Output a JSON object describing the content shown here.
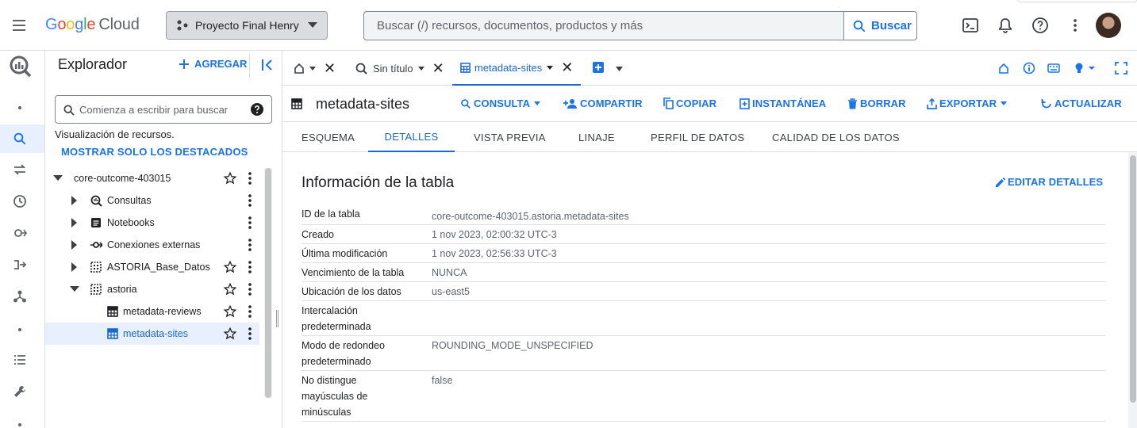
{
  "brand": {
    "google": "Google",
    "cloud": "Cloud"
  },
  "project": {
    "name": "Proyecto Final Henry"
  },
  "search": {
    "placeholder": "Buscar (/) recursos, documentos, productos y más",
    "button": "Buscar"
  },
  "explorer": {
    "title": "Explorador",
    "add": "AGREGAR",
    "search_placeholder": "Comienza a escribir para buscar",
    "resources_text": "Visualización de recursos.",
    "starred_link": "MOSTRAR SOLO LOS DESTACADOS",
    "tree": [
      {
        "label": "core-outcome-403015",
        "expanded": true,
        "icon": "none",
        "starred": false
      },
      {
        "label": "Consultas",
        "icon": "query-icon"
      },
      {
        "label": "Notebooks",
        "icon": "notebook-icon"
      },
      {
        "label": "Conexiones externas",
        "icon": "connection-icon"
      },
      {
        "label": "ASTORIA_Base_Datos",
        "icon": "dataset-icon"
      },
      {
        "label": "astoria",
        "icon": "dataset-icon",
        "expanded": true
      },
      {
        "label": "metadata-reviews",
        "icon": "table-icon"
      },
      {
        "label": "metadata-sites",
        "icon": "table-icon",
        "selected": true
      }
    ]
  },
  "tabs": [
    {
      "label": "",
      "icon": "home-icon"
    },
    {
      "label": "Sin título",
      "icon": "query-icon"
    },
    {
      "label": "metadata-sites",
      "icon": "table-icon",
      "active": true
    }
  ],
  "toolbar": {
    "title": "metadata-sites",
    "actions": [
      "CONSULTA",
      "COMPARTIR",
      "COPIAR",
      "INSTANTÁNEA",
      "BORRAR",
      "EXPORTAR",
      "ACTUALIZAR"
    ]
  },
  "subtabs": [
    "ESQUEMA",
    "DETALLES",
    "VISTA PREVIA",
    "LINAJE",
    "PERFIL DE DATOS",
    "CALIDAD DE LOS DATOS"
  ],
  "details": {
    "title": "Información de la tabla",
    "edit": "EDITAR DETALLES",
    "rows": [
      {
        "key": "ID de la tabla",
        "value": "core-outcome-403015.astoria.metadata-sites"
      },
      {
        "key": "Creado",
        "value": "1 nov 2023, 02:00:32 UTC-3"
      },
      {
        "key": "Última modificación",
        "value": "1 nov 2023, 02:56:33 UTC-3"
      },
      {
        "key": "Vencimiento de la tabla",
        "value": "NUNCA"
      },
      {
        "key": "Ubicación de los datos",
        "value": "us-east5"
      },
      {
        "key": "Intercalación predeterminada",
        "value": ""
      },
      {
        "key": "Modo de redondeo predeterminado",
        "value": "ROUNDING_MODE_UNSPECIFIED"
      },
      {
        "key": "No distingue mayúsculas de minúsculas",
        "value": "false"
      }
    ]
  },
  "colors": {
    "accent": "#1a73e8",
    "selected_bg": "#e8f0fe"
  }
}
